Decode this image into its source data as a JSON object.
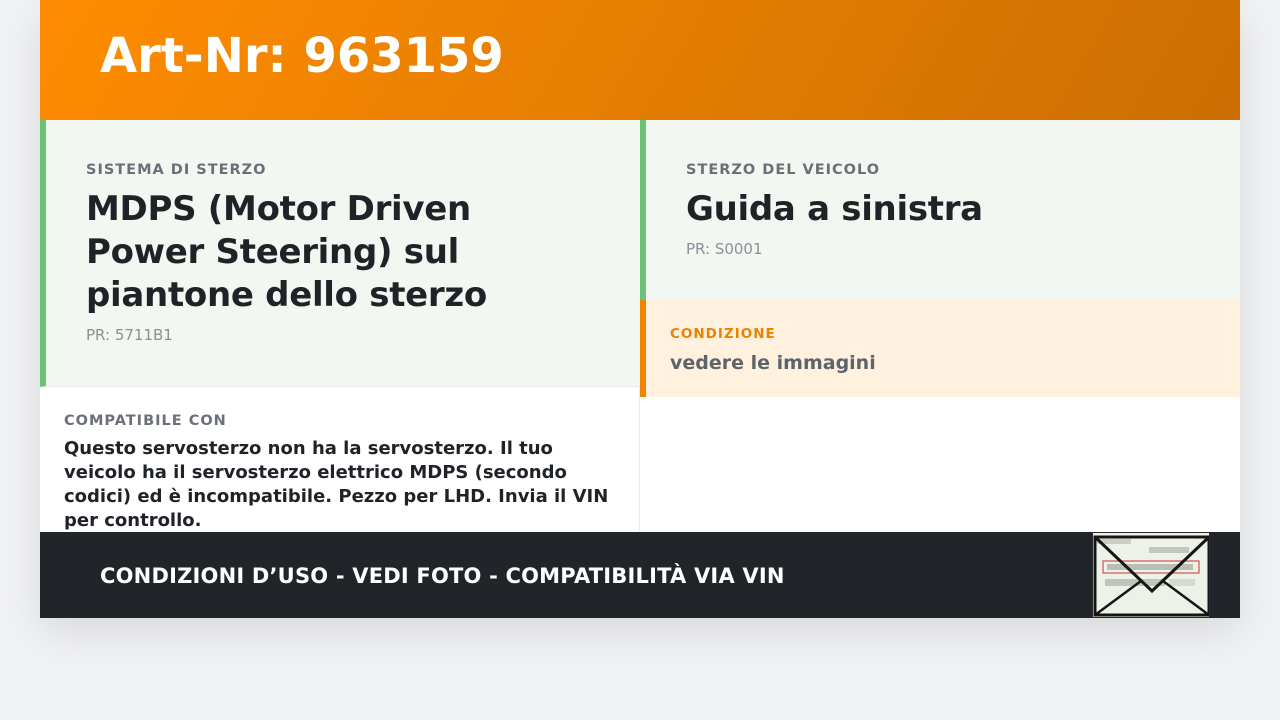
{
  "header": {
    "title": "Art-Nr: 963159"
  },
  "steering_system": {
    "label": "SISTEMA DI STERZO",
    "value": "MDPS (Motor Driven Power Steering) sul piantone dello sterzo",
    "pr": "PR: 5711B1"
  },
  "vehicle_steering": {
    "label": "STERZO DEL VEICOLO",
    "value": "Guida a sinistra",
    "pr": "PR: S0001"
  },
  "condition": {
    "label": "CONDIZIONE",
    "value": "vedere le immagini"
  },
  "compatibility": {
    "label": "COMPATIBILE CON",
    "text": "Questo servosterzo non ha la servosterzo. Il tuo veicolo ha il servosterzo elettrico MDPS (secondo codici) ed è incompatibile. Pezzo per LHD. Invia il VIN per controllo."
  },
  "footer": {
    "text": "CONDIZIONI D’USO - VEDI FOTO - COMPATIBILITÀ VIA VIN"
  },
  "thumbnail": {
    "icon": "envelope-icon"
  },
  "colors": {
    "header_start": "#ff8c00",
    "header_end": "#cc6e02",
    "green_accent": "#6cc275",
    "orange_accent": "#f08600",
    "footer_bg": "#212429"
  }
}
